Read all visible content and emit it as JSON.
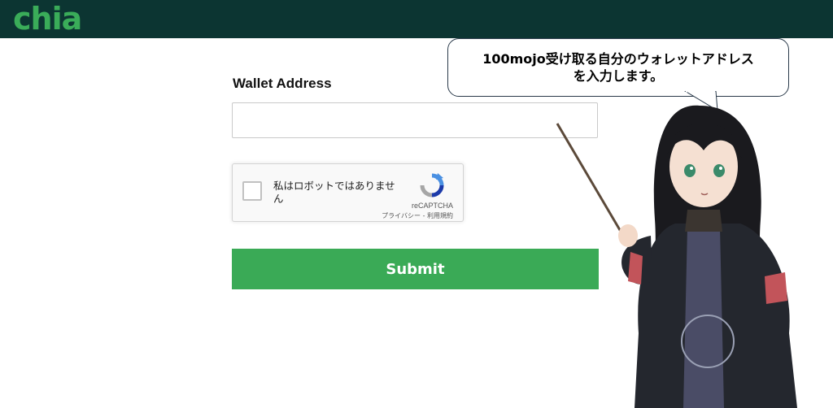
{
  "header": {
    "logo_text": "chia",
    "brand_color": "#3aac59",
    "bar_color": "#0c3532"
  },
  "form": {
    "wallet_label": "Wallet Address",
    "wallet_value": "",
    "wallet_placeholder": "",
    "submit_label": "Submit",
    "submit_color": "#3aaa56"
  },
  "captcha": {
    "checkbox_label": "私はロボットではありません",
    "brand": "reCAPTCHA",
    "privacy_link": "プライバシー",
    "separator": "-",
    "terms_link": "利用規約",
    "checked": false
  },
  "annotation": {
    "bubble_line1": "100mojo受け取る自分のウォレットアドレス",
    "bubble_line2": "を入力します。"
  },
  "icons": {
    "logo": "chia-logo",
    "captcha": "recaptcha-logo-icon",
    "character": "guide-character-with-pointer"
  }
}
